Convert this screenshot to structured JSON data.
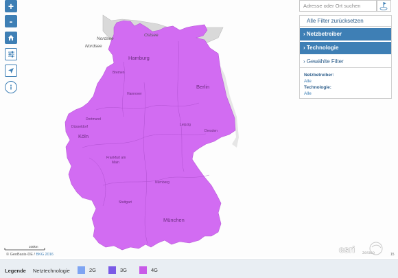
{
  "controls": {
    "zoom_in": "+",
    "zoom_out": "-",
    "home_icon": "home-icon",
    "filter_icon": "sliders-icon",
    "locate_icon": "location-arrow-icon",
    "info_icon": "info-icon"
  },
  "search": {
    "placeholder": "Adresse oder Ort suchen"
  },
  "filter_panel": {
    "reset_label": "Alle Filter zurücksetzen",
    "tabs": [
      {
        "label": "Netzbetreiber"
      },
      {
        "label": "Technologie"
      },
      {
        "label": "Gewählte Filter"
      }
    ],
    "selected": {
      "operator_label": "Netzbetreiber:",
      "operator_value": "Alle",
      "technology_label": "Technologie:",
      "technology_value": "Alle"
    }
  },
  "map": {
    "seas": [
      "Ostsee",
      "Nordsee",
      "Nordsee"
    ],
    "cities": {
      "hamburg": "Hamburg",
      "bremen": "Bremen",
      "hannover": "Hannover",
      "berlin": "Berlin",
      "dortmund": "Dortmund",
      "duesseldorf": "Düsseldorf",
      "koeln": "Köln",
      "leipzig": "Leipzig",
      "dresden": "Dresden",
      "frankfurt_1": "Frankfurt am",
      "frankfurt_2": "Main",
      "nuernberg": "Nürnberg",
      "stuttgart": "Stuttgart",
      "muenchen": "München"
    },
    "coverage_color": "#d26cf2",
    "scale_label": "100km",
    "copyright_text": "© GeoBasis-DE / ",
    "copyright_link": "BKG 2016",
    "esri_logo": "esri",
    "partner_logo": "zeraco",
    "zoom_level": "15"
  },
  "legend": {
    "title": "Legende",
    "subtitle": "Netztechnologie",
    "items": [
      {
        "label": "2G",
        "color": "#7ea4f2"
      },
      {
        "label": "3G",
        "color": "#7a5ae6"
      },
      {
        "label": "4G",
        "color": "#c85ae8"
      }
    ]
  }
}
